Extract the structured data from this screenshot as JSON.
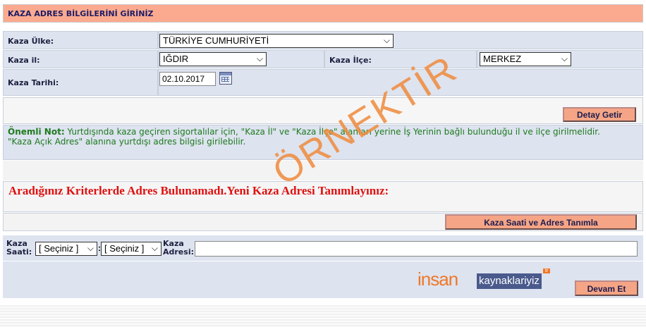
{
  "header": {
    "title": "KAZA ADRES BİLGİLERİNİ GİRİNİZ"
  },
  "form": {
    "ulke_label": "Kaza Ülke:",
    "ulke_value": "TÜRKİYE CUMHURİYETİ",
    "il_label": "Kaza il:",
    "il_value": "IĞDIR",
    "ilce_label": "Kaza İlçe:",
    "ilce_value": "MERKEZ",
    "tarih_label": "Kaza Tarihi:",
    "tarih_value": "02.10.2017"
  },
  "buttons": {
    "detay": "Detay Getir",
    "kaza_saati": "Kaza Saati ve Adres Tanımla",
    "devam": "Devam Et"
  },
  "note": {
    "title": "Önemli Not:",
    "line1": " Yurtdışında kaza geçiren sigortalılar için, \"Kaza İl\" ve \"Kaza İlçe\" alanları yerine İş Yerinin bağlı bulunduğu il ve ilçe girilmelidir.",
    "line2": "\"Kaza Açık Adres\" alanına yurtdışı adres bilgisi girilebilir."
  },
  "message": "Aradığınız Kriterlerde Adres Bulunamadı.Yeni Kaza Adresi Tanımlayınız:",
  "bottom": {
    "saati_label_1": "Kaza",
    "saati_label_2": "Saati:",
    "hour_value": "[ Seçiniz ]",
    "minute_value": "[ Seçiniz ]",
    "adres_label_1": "Kaza",
    "adres_label_2": "Adresi:",
    "adres_value": ""
  },
  "watermark": "ÖRNEKTİR",
  "logo": {
    "part1": "insan",
    "part2": "kaynaklariyiz",
    "badge": "tr"
  },
  "colors": {
    "header_bg": "#fbaa8f",
    "label_bg": "#dde3ef",
    "button_bg": "#f5a585",
    "note": "#1e7a1e",
    "error": "#e01010",
    "stamp": "#f08a3c"
  }
}
